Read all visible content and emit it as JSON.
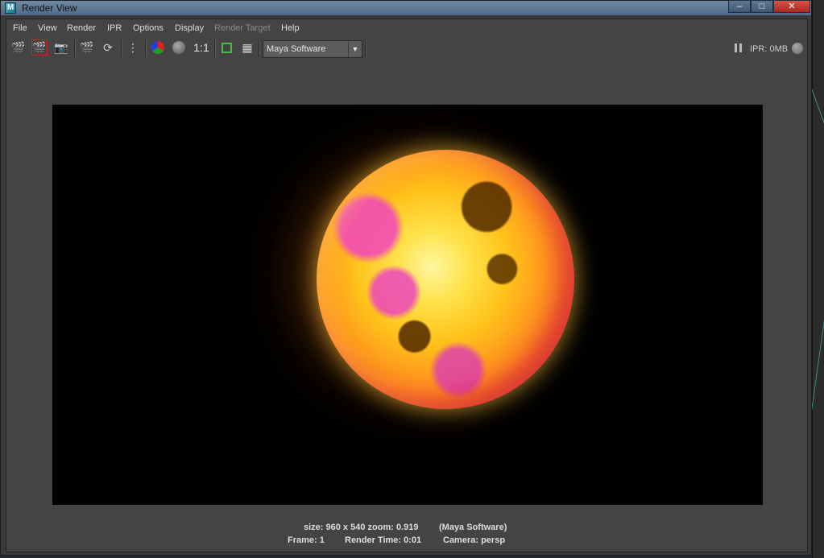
{
  "window": {
    "title": "Render View"
  },
  "menubar": {
    "items": [
      "File",
      "View",
      "Render",
      "IPR",
      "Options",
      "Display",
      "Render Target",
      "Help"
    ]
  },
  "toolbar": {
    "icons": [
      "redo-render-icon",
      "render-region-icon",
      "snapshot-icon",
      "ipr-render-icon",
      "refresh-icon",
      "render-sequence-icon",
      "rgb-channels-icon",
      "alpha-channel-icon",
      "real-size-icon",
      "keep-image-icon",
      "remove-image-icon"
    ],
    "one_to_one": "1:1",
    "renderer": "Maya Software"
  },
  "ipr": {
    "label": "IPR: 0MB"
  },
  "info": {
    "size": "size: 960 x 540 zoom: 0.919",
    "renderer": "(Maya Software)",
    "frame": "Frame: 1",
    "render_time": "Render Time: 0:01",
    "camera": "Camera: persp"
  },
  "colors": {
    "window_bg": "#444444",
    "title_bar": "#4f6a86",
    "render_bg": "#000000",
    "close_button": "#c7372d"
  }
}
